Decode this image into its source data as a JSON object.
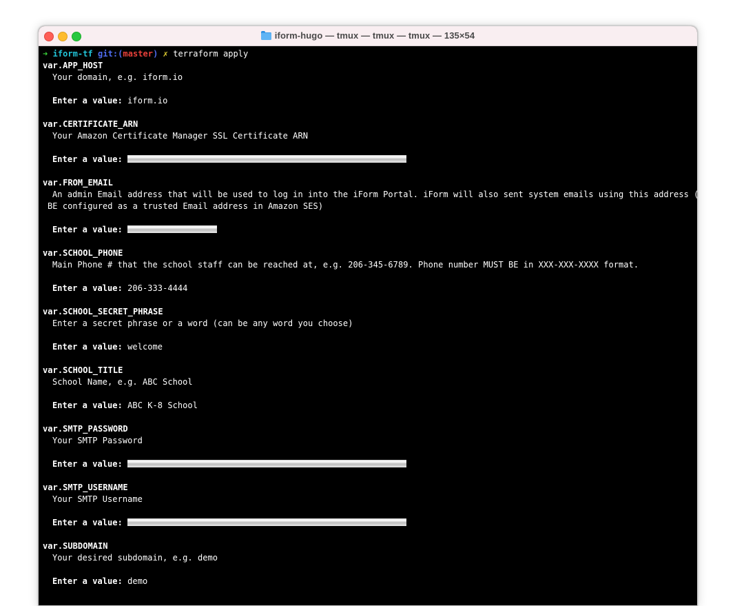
{
  "window": {
    "title": "iform-hugo — tmux — tmux — tmux — 135×54"
  },
  "prompt": {
    "arrow": "➜",
    "directory": "iform-tf",
    "git_label": "git:(",
    "branch": "master",
    "git_close": ")",
    "dirty_mark": "✗",
    "command": "terraform apply"
  },
  "enter_label": "Enter a value:",
  "variables": [
    {
      "name": "var.APP_HOST",
      "description": [
        "Your domain, e.g. iform.io"
      ],
      "value": "iform.io",
      "redacted": false
    },
    {
      "name": "var.CERTIFICATE_ARN",
      "description": [
        "Your Amazon Certificate Manager SSL Certificate ARN"
      ],
      "value": "",
      "redacted": true
    },
    {
      "name": "var.FROM_EMAIL",
      "description": [
        "An admin Email address that will be used to log in into the iForm Portal. iForm will also sent system emails using this address (MUST",
        "BE configured as a trusted Email address in Amazon SES)"
      ],
      "value": "",
      "redacted": true
    },
    {
      "name": "var.SCHOOL_PHONE",
      "description": [
        "Main Phone # that the school staff can be reached at, e.g. 206-345-6789. Phone number MUST BE in XXX-XXX-XXXX format."
      ],
      "value": "206-333-4444",
      "redacted": false
    },
    {
      "name": "var.SCHOOL_SECRET_PHRASE",
      "description": [
        "Enter a secret phrase or a word (can be any word you choose)"
      ],
      "value": "welcome",
      "redacted": false
    },
    {
      "name": "var.SCHOOL_TITLE",
      "description": [
        "School Name, e.g. ABC School"
      ],
      "value": "ABC K-8 School",
      "redacted": false
    },
    {
      "name": "var.SMTP_PASSWORD",
      "description": [
        "Your SMTP Password"
      ],
      "value": "",
      "redacted": true
    },
    {
      "name": "var.SMTP_USERNAME",
      "description": [
        "Your SMTP Username"
      ],
      "value": "",
      "redacted": true
    },
    {
      "name": "var.SUBDOMAIN",
      "description": [
        "Your desired subdomain, e.g. demo"
      ],
      "value": "demo",
      "redacted": false
    }
  ],
  "colors": {
    "terminal_bg": "#000000",
    "titlebar_bg": "#f9eef1",
    "prompt_arrow": "#3ad53a",
    "prompt_dir": "#22c4d8",
    "prompt_git": "#4f6cf0",
    "prompt_branch": "#e8403a",
    "prompt_dirty": "#e6d333"
  }
}
